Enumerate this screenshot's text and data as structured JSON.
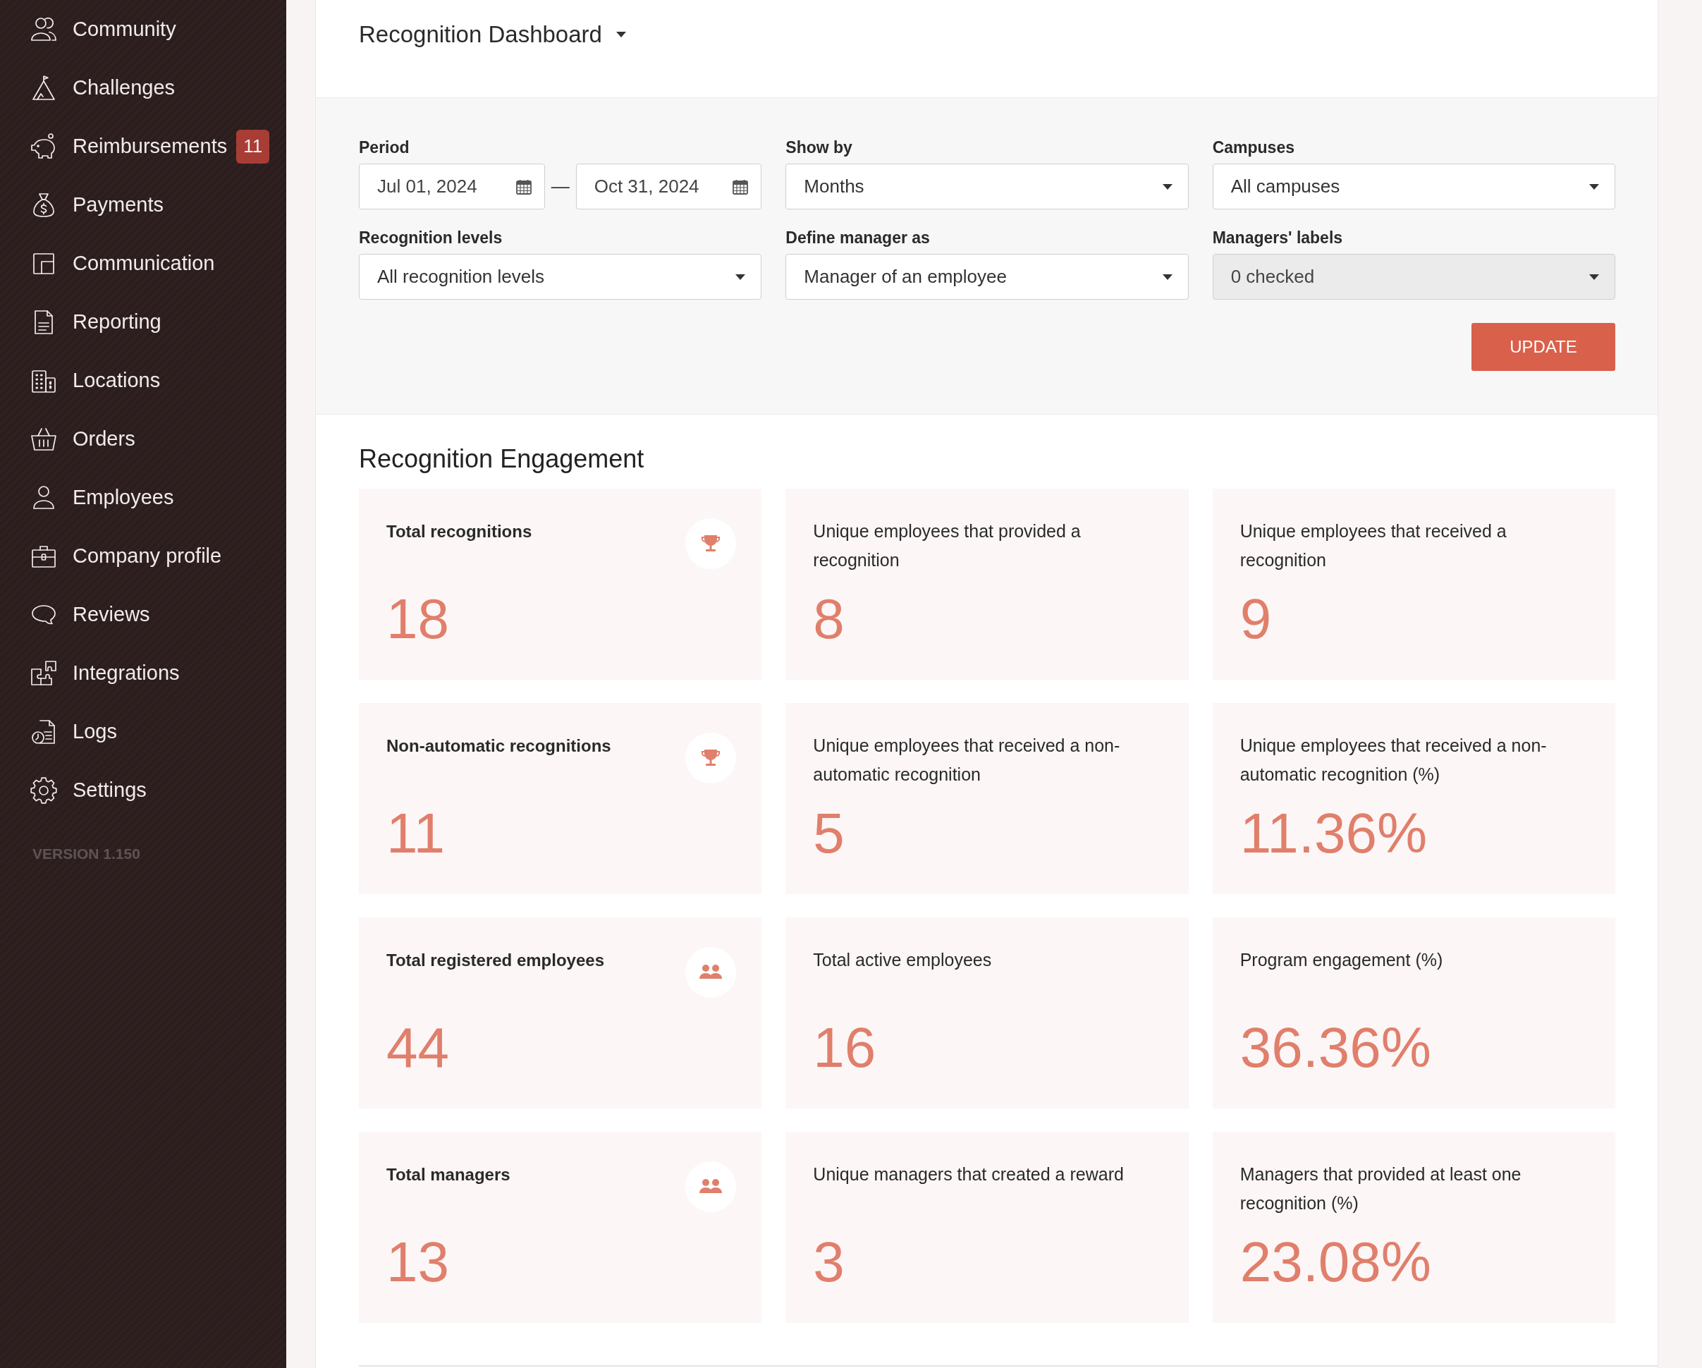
{
  "sidebar": {
    "items": [
      {
        "label": "Community"
      },
      {
        "label": "Challenges"
      },
      {
        "label": "Reimbursements",
        "badge": "11"
      },
      {
        "label": "Payments"
      },
      {
        "label": "Communication"
      },
      {
        "label": "Reporting"
      },
      {
        "label": "Locations"
      },
      {
        "label": "Orders"
      },
      {
        "label": "Employees"
      },
      {
        "label": "Company profile"
      },
      {
        "label": "Reviews"
      },
      {
        "label": "Integrations"
      },
      {
        "label": "Logs"
      },
      {
        "label": "Settings"
      }
    ],
    "version": "VERSION 1.150"
  },
  "header": {
    "title": "Recognition Dashboard"
  },
  "filters": [
    {
      "kind": "date_range",
      "label": "Period",
      "from": "Jul 01, 2024",
      "separator": "—",
      "to": "Oct 31, 2024",
      "disabled": false
    },
    {
      "kind": "select",
      "label": "Show by",
      "value": "Months",
      "disabled": false
    },
    {
      "kind": "select",
      "label": "Campuses",
      "value": "All campuses",
      "disabled": false
    },
    {
      "kind": "select",
      "label": "Recognition levels",
      "value": "All recognition levels",
      "disabled": false
    },
    {
      "kind": "select",
      "label": "Define manager as",
      "value": "Manager of an employee",
      "disabled": false
    },
    {
      "kind": "select",
      "label": "Managers' labels",
      "value": "0 checked",
      "disabled": true
    }
  ],
  "update_button": "UPDATE",
  "engagement": {
    "title": "Recognition Engagement",
    "cards": [
      {
        "kind": "total",
        "label": "Total recognitions",
        "value": "18"
      },
      {
        "kind": "detail",
        "label": "Unique employees that provided a recognition",
        "value": "8"
      },
      {
        "kind": "detail",
        "label": "Unique employees that received a recognition",
        "value": "9"
      },
      {
        "kind": "total",
        "label": "Non-automatic recognitions",
        "value": "11"
      },
      {
        "kind": "detail",
        "label": "Unique employees that received a non-automatic recognition",
        "value": "5"
      },
      {
        "kind": "detail",
        "label": "Unique employees that received a non-automatic recognition (%)",
        "value": "11.36%"
      },
      {
        "kind": "total",
        "label": "Total registered employees",
        "value": "44"
      },
      {
        "kind": "detail",
        "label": "Total active employees",
        "value": "16"
      },
      {
        "kind": "detail",
        "label": "Program engagement (%)",
        "value": "36.36%"
      },
      {
        "kind": "total",
        "label": "Total managers",
        "value": "13"
      },
      {
        "kind": "detail",
        "label": "Unique managers that created a reward",
        "value": "3"
      },
      {
        "kind": "detail",
        "label": "Managers that provided at least one recognition (%)",
        "value": "23.08%"
      }
    ]
  }
}
